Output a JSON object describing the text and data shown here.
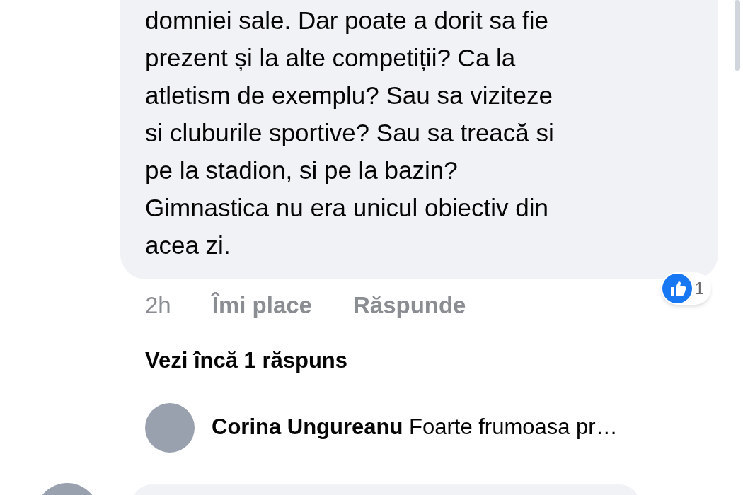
{
  "comment": {
    "lines": [
      "domniei sale. Dar poate a dorit sa fie",
      "prezent și la alte competiții? Ca la",
      "atletism de exemplu? Sau sa viziteze",
      "si cluburile sportive? Sau sa treacă si",
      "pe la stadion, si pe la bazin?",
      "Gimnastica nu era unicul obiectiv din",
      "acea zi."
    ],
    "time": "2h",
    "actions": [
      "Îmi place",
      "Răspunde"
    ],
    "reaction_count": "1"
  },
  "more_replies": "Vezi încă 1 răspuns",
  "reply": {
    "author": "Corina Ungureanu",
    "text": "Foarte frumoasa pr…"
  }
}
